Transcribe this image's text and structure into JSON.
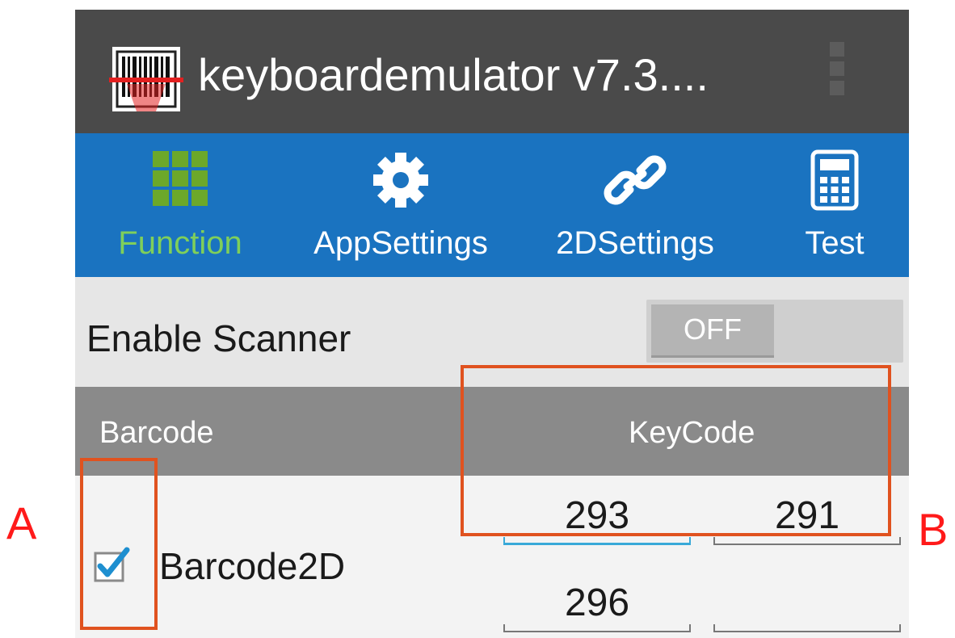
{
  "app": {
    "title": "keyboardemulator v7.3....",
    "icon": "barcode-scanner-icon"
  },
  "tabs": [
    {
      "label": "Function",
      "icon": "grid-icon",
      "active": true
    },
    {
      "label": "AppSettings",
      "icon": "gear-icon",
      "active": false
    },
    {
      "label": "2DSettings",
      "icon": "link-icon",
      "active": false
    },
    {
      "label": "Test",
      "icon": "calculator-icon",
      "active": false
    }
  ],
  "scanner": {
    "label": "Enable Scanner",
    "toggle_state": "OFF"
  },
  "table": {
    "header_barcode": "Barcode",
    "header_keycode": "KeyCode",
    "rows": [
      {
        "name": "Barcode2D",
        "checked": true,
        "keycodes": [
          "293",
          "291",
          "296",
          ""
        ]
      }
    ]
  },
  "annotations": {
    "a": "A",
    "b": "B"
  },
  "colors": {
    "action_bar": "#4a4a4a",
    "tab_bar": "#1a73c0",
    "active_tab": "#7fcf5a",
    "annotation_box": "#e0521f",
    "annotation_letter": "#ff1a1a",
    "focus_underline": "#39a9d8"
  }
}
